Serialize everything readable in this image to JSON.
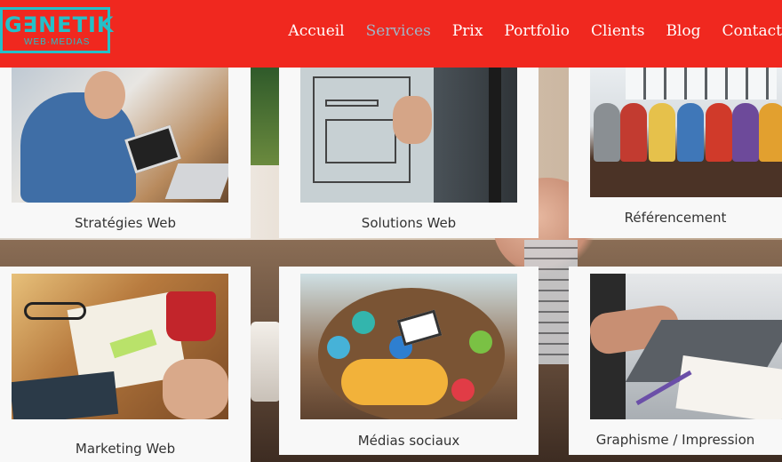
{
  "brand": {
    "logo_title": "G∃NETIK",
    "logo_subtitle": "WEB·MEDIAS",
    "header_color": "#f0281f",
    "logo_color": "#24c0c9"
  },
  "nav": {
    "items": [
      {
        "label": "Accueil",
        "active": false
      },
      {
        "label": "Services",
        "active": true
      },
      {
        "label": "Prix",
        "active": false
      },
      {
        "label": "Portfolio",
        "active": false
      },
      {
        "label": "Clients",
        "active": false
      },
      {
        "label": "Blog",
        "active": false
      },
      {
        "label": "Contact",
        "active": false
      }
    ]
  },
  "services": [
    {
      "title": "Stratégies Web",
      "icon": "strategy-photo"
    },
    {
      "title": "Solutions Web",
      "icon": "wireframe-photo"
    },
    {
      "title": "Référencement",
      "icon": "team-photo"
    },
    {
      "title": "Marketing Web",
      "icon": "ideas-photo"
    },
    {
      "title": "Médias sociaux",
      "icon": "social-photo"
    },
    {
      "title": "Graphisme / Impression",
      "icon": "design-photo"
    }
  ]
}
